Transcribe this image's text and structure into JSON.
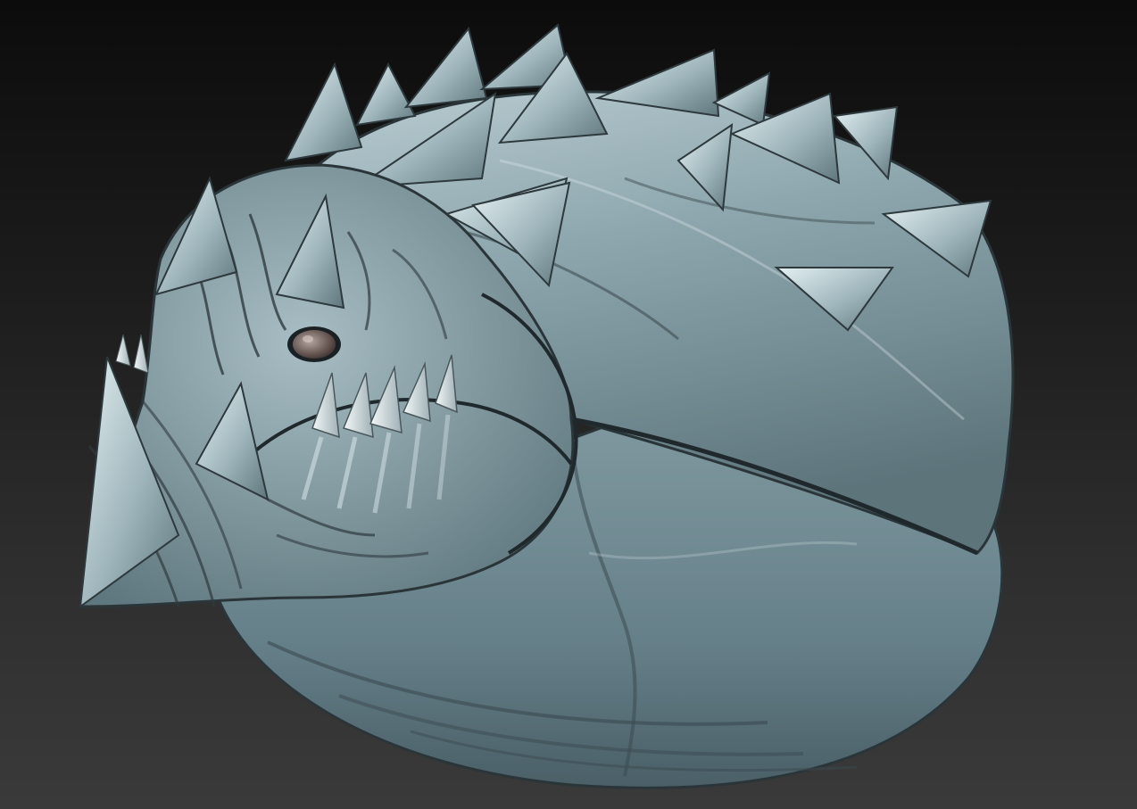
{
  "scene": {
    "subject_icon": "creature-head-sculpt-icon",
    "background_top_color": "#0c0c0c",
    "background_bottom_color": "#3a3a3a",
    "material_base_color": "#7f9aa2",
    "material_highlight_color": "#dce9ec",
    "material_shadow_color": "#2b363b",
    "eye_color": "#8a7670"
  }
}
